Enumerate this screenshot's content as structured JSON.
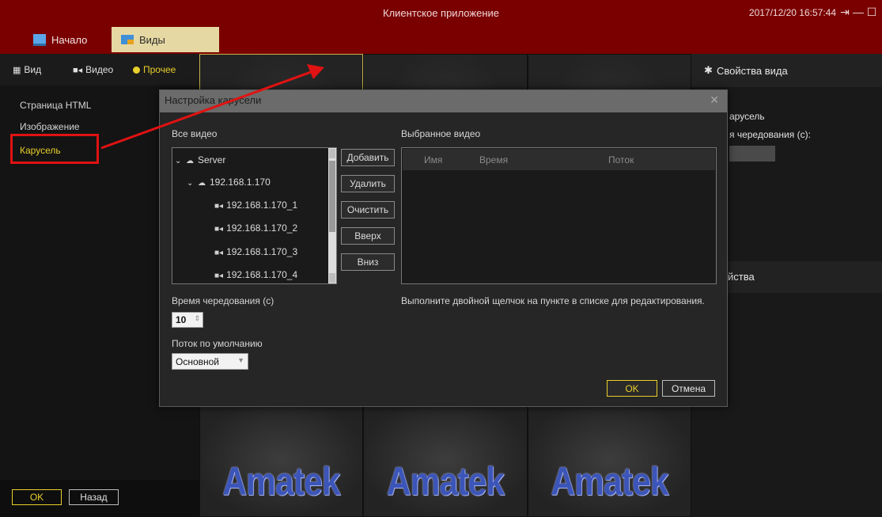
{
  "window": {
    "title": "Клиентское приложение",
    "datetime": "2017/12/20 16:57:44",
    "controls": {
      "logout": "⇥",
      "minimize": "—",
      "maximize": "☐",
      "close": "✕"
    }
  },
  "main_tabs": [
    {
      "label": "Начало",
      "icon": "monitor-icon"
    },
    {
      "label": "Виды",
      "icon": "grid-icon",
      "active": true
    }
  ],
  "left_panel": {
    "tabs": [
      {
        "label": "Вид",
        "icon": "grid-icon"
      },
      {
        "label": "Видео",
        "icon": "camera-icon"
      },
      {
        "label": "Прочее",
        "icon": "dot-icon",
        "active": true
      }
    ],
    "items": [
      {
        "label": "Страница HTML"
      },
      {
        "label": "Изображение"
      },
      {
        "label": "Карусель",
        "active": true
      }
    ],
    "ok_label": "OK",
    "back_label": "Назад"
  },
  "center": {
    "brand_text": "Amatek"
  },
  "right_panel": {
    "title": "Свойства вида",
    "carousel_label": "арусель",
    "interval_label": "я чередования (с):",
    "properties_label": "войства"
  },
  "modal": {
    "title": "Настройка карусели",
    "close": "✕",
    "all_video_label": "Все видео",
    "selected_video_label": "Выбранное видео",
    "tree": [
      {
        "label": "Server",
        "level": 0,
        "type": "server",
        "expanded": true
      },
      {
        "label": "192.168.1.170",
        "level": 1,
        "type": "server",
        "expanded": true
      },
      {
        "label": "192.168.1.170_1",
        "level": 2,
        "type": "camera"
      },
      {
        "label": "192.168.1.170_2",
        "level": 2,
        "type": "camera"
      },
      {
        "label": "192.168.1.170_3",
        "level": 2,
        "type": "camera"
      },
      {
        "label": "192.168.1.170_4",
        "level": 2,
        "type": "camera"
      }
    ],
    "buttons": {
      "add": "Добавить",
      "delete": "Удалить",
      "clear": "Очистить",
      "up": "Вверх",
      "down": "Вниз"
    },
    "table_columns": [
      "Имя",
      "Время",
      "Поток"
    ],
    "hint": "Выполните двойной щелчок на пункте в списке для редактирования.",
    "interval_label": "Время чередования (с)",
    "interval_value": "10",
    "default_stream_label": "Поток по умолчанию",
    "default_stream_value": "Основной",
    "ok_label": "OK",
    "cancel_label": "Отмена"
  },
  "colors": {
    "titlebar": "#7a0000",
    "accent_yellow": "#e8cf2b",
    "highlight_red": "#e01212",
    "brand_blue": "#3c55b8"
  }
}
